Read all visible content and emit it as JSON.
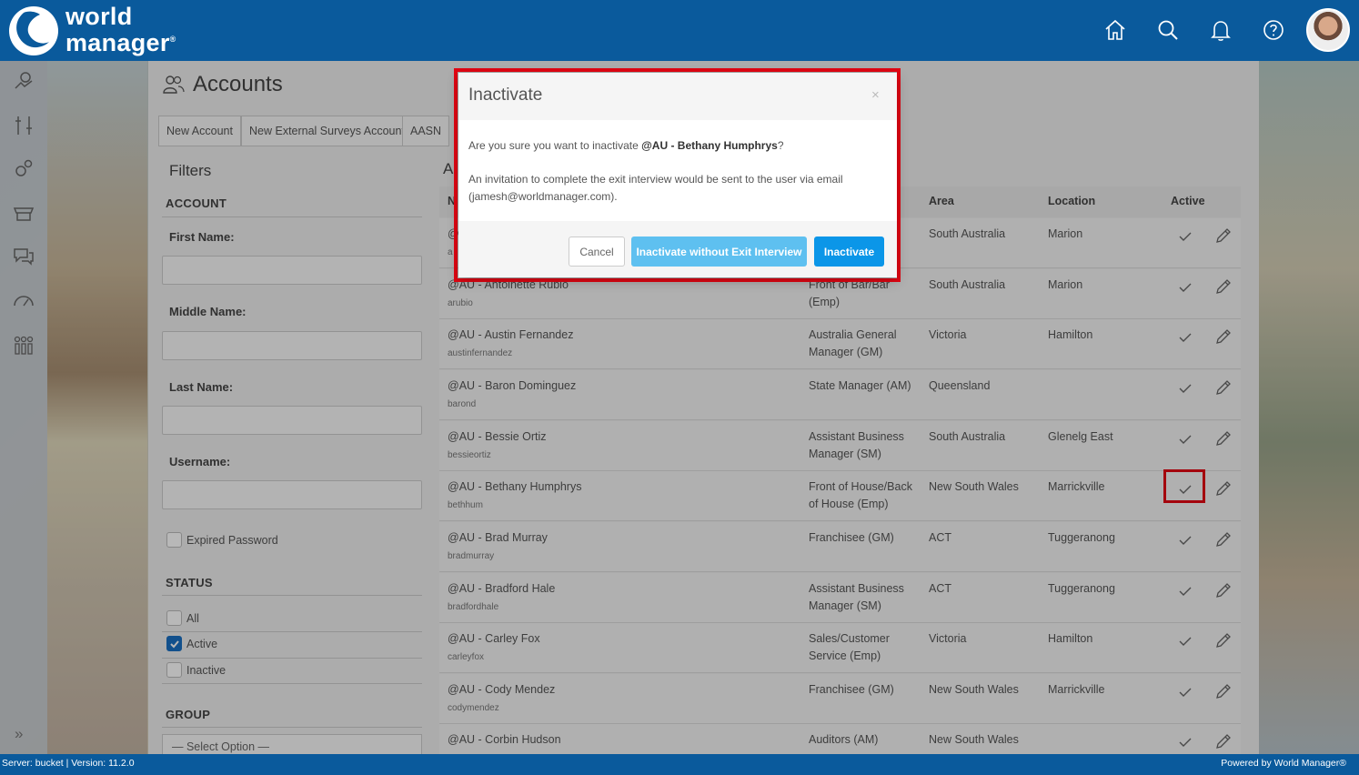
{
  "brand": {
    "line1": "world",
    "line2": "manager",
    "trademark": "®",
    "color": "#0a5a9c"
  },
  "top_icons": [
    "home-icon",
    "search-icon",
    "bell-icon",
    "help-icon"
  ],
  "rail_icons": [
    "map-icon",
    "tools-icon",
    "gears-icon",
    "store-icon",
    "chat-icon",
    "gauge-icon",
    "people-icon"
  ],
  "page": {
    "title": "Accounts",
    "buttons": [
      "New Account",
      "New External Surveys Account",
      "AASN"
    ],
    "list_heading_partial": "A"
  },
  "filters": {
    "title": "Filters",
    "account_section": "ACCOUNT",
    "first_name": "First Name:",
    "middle_name": "Middle Name:",
    "last_name": "Last Name:",
    "username": "Username:",
    "expired_password": "Expired Password",
    "status_section": "STATUS",
    "status_options": [
      {
        "label": "All",
        "checked": false
      },
      {
        "label": "Active",
        "checked": true
      },
      {
        "label": "Inactive",
        "checked": false
      }
    ],
    "group_section": "GROUP",
    "group_placeholder": "— Select Option —"
  },
  "table": {
    "columns": {
      "name": "N",
      "area": "Area",
      "location": "Location",
      "active": "Active"
    },
    "rows": [
      {
        "name": "@",
        "user": "a",
        "role": "",
        "area": "South Australia",
        "location": "Marion"
      },
      {
        "name": "@AU - Antoinette Rubio",
        "user": "arubio",
        "role": "Front of Bar/Bar (Emp)",
        "area": "South Australia",
        "location": "Marion"
      },
      {
        "name": "@AU - Austin Fernandez",
        "user": "austinfernandez",
        "role": "Australia General Manager (GM)",
        "area": "Victoria",
        "location": "Hamilton"
      },
      {
        "name": "@AU - Baron Dominguez",
        "user": "barond",
        "role": "State Manager (AM)",
        "area": "Queensland",
        "location": ""
      },
      {
        "name": "@AU - Bessie Ortiz",
        "user": "bessieortiz",
        "role": "Assistant Business Manager (SM)",
        "area": "South Australia",
        "location": "Glenelg East"
      },
      {
        "name": "@AU - Bethany Humphrys",
        "user": "bethhum",
        "role": "Front of House/Back of House (Emp)",
        "area": "New South Wales",
        "location": "Marrickville"
      },
      {
        "name": "@AU - Brad Murray",
        "user": "bradmurray",
        "role": "Franchisee (GM)",
        "area": "ACT",
        "location": "Tuggeranong"
      },
      {
        "name": "@AU - Bradford Hale",
        "user": "bradfordhale",
        "role": "Assistant Business Manager (SM)",
        "area": "ACT",
        "location": "Tuggeranong"
      },
      {
        "name": "@AU - Carley Fox",
        "user": "carleyfox",
        "role": "Sales/Customer Service (Emp)",
        "area": "Victoria",
        "location": "Hamilton"
      },
      {
        "name": "@AU - Cody Mendez",
        "user": "codymendez",
        "role": "Franchisee (GM)",
        "area": "New South Wales",
        "location": "Marrickville"
      },
      {
        "name": "@AU - Corbin Hudson",
        "user": "",
        "role": "Auditors (AM)",
        "area": "New South Wales",
        "location": ""
      }
    ]
  },
  "modal": {
    "title": "Inactivate",
    "close": "×",
    "line1_prefix": "Are you sure you want to inactivate ",
    "line1_name": "@AU - Bethany Humphrys",
    "line1_suffix": "?",
    "line2": "An invitation to complete the exit interview would be sent to the user via email (jamesh@worldmanager.com).",
    "cancel": "Cancel",
    "without_exit": "Inactivate without Exit Interview",
    "inactivate": "Inactivate"
  },
  "footer": {
    "left": "Server: bucket  |   Version: 11.2.0",
    "right": "Powered by World Manager®"
  },
  "rail_expand": "»",
  "highlight_color": "#e30613"
}
